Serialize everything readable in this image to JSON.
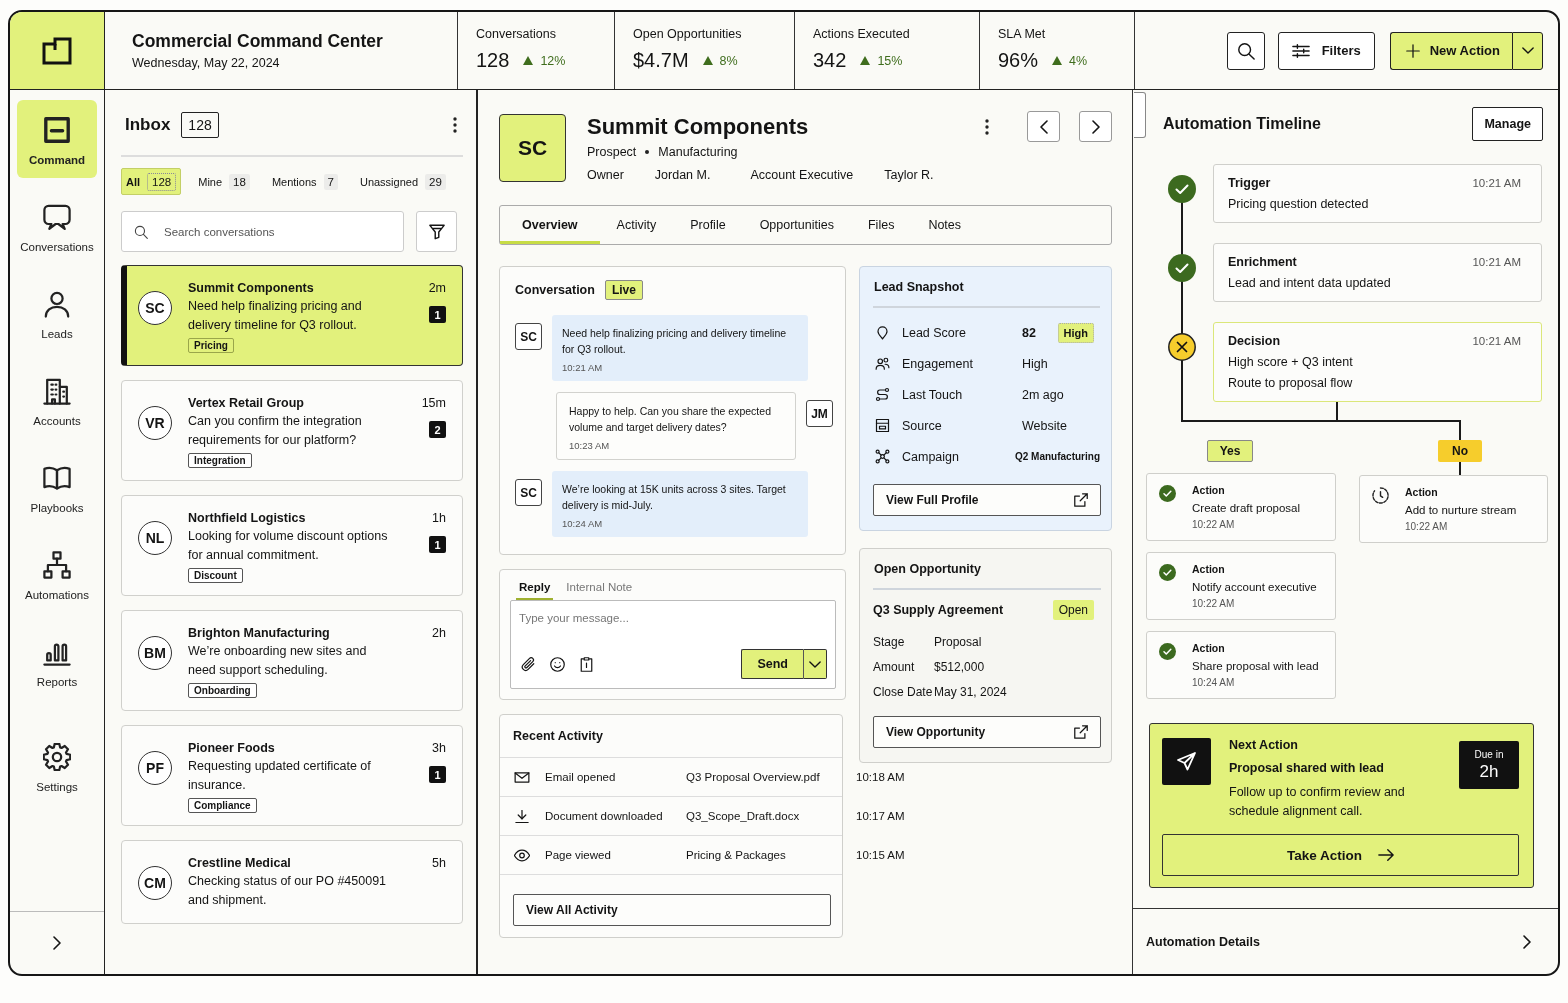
{
  "header": {
    "title": "Commercial Command Center",
    "date": "Wednesday, May 22, 2024"
  },
  "stats": [
    {
      "label": "Conversations",
      "value": "128",
      "change": "12%"
    },
    {
      "label": "Open Opportunities",
      "value": "$4.7M",
      "change": "8%"
    },
    {
      "label": "Actions Executed",
      "value": "342",
      "change": "15%"
    },
    {
      "label": "SLA Met",
      "value": "96%",
      "change": "4%"
    }
  ],
  "toolbar": {
    "filters": "Filters",
    "new_action": "New Action"
  },
  "sidebar": {
    "items": [
      {
        "label": "Command",
        "selected": true
      },
      {
        "label": "Conversations",
        "selected": false
      },
      {
        "label": "Leads",
        "selected": false
      },
      {
        "label": "Accounts",
        "selected": false
      },
      {
        "label": "Playbooks",
        "selected": false
      },
      {
        "label": "Automations",
        "selected": false
      },
      {
        "label": "Reports",
        "selected": false
      },
      {
        "label": "Settings",
        "selected": false
      }
    ]
  },
  "inbox": {
    "title": "Inbox",
    "count": "128",
    "filters": [
      {
        "label": "All",
        "count": "128",
        "selected": true
      },
      {
        "label": "Mine",
        "count": "18",
        "selected": false
      },
      {
        "label": "Mentions",
        "count": "7",
        "selected": false
      },
      {
        "label": "Unassigned",
        "count": "29",
        "selected": false
      }
    ],
    "search": {
      "placeholder": "Search conversations"
    },
    "conversations": [
      {
        "initials": "SC",
        "name": "Summit Components",
        "message": "Need help finalizing pricing and delivery timeline for Q3 rollout.",
        "time": "2m",
        "unread": "1",
        "tag": "Pricing",
        "selected": true
      },
      {
        "initials": "VR",
        "name": "Vertex Retail Group",
        "message": "Can you confirm the integration requirements for our platform?",
        "time": "15m",
        "unread": "2",
        "tag": "Integration",
        "selected": false
      },
      {
        "initials": "NL",
        "name": "Northfield Logistics",
        "message": "Looking for volume discount options for annual commitment.",
        "time": "1h",
        "unread": "1",
        "tag": "Discount",
        "selected": false
      },
      {
        "initials": "BM",
        "name": "Brighton Manufacturing",
        "message": "We’re onboarding new sites and need support scheduling.",
        "time": "2h",
        "tag": "Onboarding",
        "selected": false
      },
      {
        "initials": "PF",
        "name": "Pioneer Foods",
        "message": "Requesting updated certificate of insurance.",
        "time": "3h",
        "unread": "1",
        "tag": "Compliance",
        "selected": false
      },
      {
        "initials": "CM",
        "name": "Crestline Medical",
        "message": "Checking status of our PO #450091 and shipment.",
        "time": "5h",
        "selected": false
      }
    ]
  },
  "account": {
    "initials": "SC",
    "name": "Summit Components",
    "type": "Prospect",
    "industry": "Manufacturing",
    "fields": [
      {
        "label": "Owner",
        "value": "Jordan M."
      },
      {
        "label": "Account Executive",
        "value": "Taylor R."
      }
    ]
  },
  "tabs": [
    {
      "label": "Overview",
      "selected": true
    },
    {
      "label": "Activity",
      "selected": false
    },
    {
      "label": "Profile",
      "selected": false
    },
    {
      "label": "Opportunities",
      "selected": false
    },
    {
      "label": "Files",
      "selected": false
    },
    {
      "label": "Notes",
      "selected": false
    }
  ],
  "conversation": {
    "title": "Conversation",
    "status": "Live",
    "messages": [
      {
        "kind": "inbound",
        "initials": "SC",
        "text": "Need help finalizing pricing and delivery timeline for Q3 rollout.",
        "time": "10:21 AM"
      },
      {
        "kind": "outbound",
        "initials": "JM",
        "text": "Happy to help. Can you share the expected volume and target delivery dates?",
        "time": "10:23 AM"
      },
      {
        "kind": "inbound",
        "initials": "SC",
        "text": "We’re looking at 15K units across 3 sites. Target delivery is mid-July.",
        "time": "10:24 AM"
      }
    ]
  },
  "reply": {
    "tabs": [
      {
        "label": "Reply",
        "selected": true
      },
      {
        "label": "Internal Note",
        "selected": false
      }
    ],
    "placeholder": "Type your message...",
    "send": "Send"
  },
  "recent_activity": {
    "title": "Recent Activity",
    "rows": [
      {
        "event": "Email opened",
        "item": "Q3 Proposal Overview.pdf",
        "time": "10:18 AM"
      },
      {
        "event": "Document downloaded",
        "item": "Q3_Scope_Draft.docx",
        "time": "10:17 AM"
      },
      {
        "event": "Page viewed",
        "item": "Pricing & Packages",
        "time": "10:15 AM"
      }
    ],
    "button": "View All Activity"
  },
  "lead_snapshot": {
    "title": "Lead Snapshot",
    "rows": [
      {
        "kind": "score",
        "label": "Lead Score",
        "value": "82",
        "badge": "High"
      },
      {
        "kind": "plain",
        "label": "Engagement",
        "value": "High"
      },
      {
        "kind": "plain",
        "label": "Last Touch",
        "value": "2m ago"
      },
      {
        "kind": "plain",
        "label": "Source",
        "value": "Website"
      },
      {
        "kind": "compact",
        "label": "Campaign",
        "value": "Q2 Manufacturing"
      }
    ],
    "button": "View Full Profile"
  },
  "opportunity": {
    "title": "Open Opportunity",
    "name": "Q3 Supply Agreement",
    "status": "Open",
    "fields": [
      {
        "label": "Stage",
        "value": "Proposal"
      },
      {
        "label": "Amount",
        "value": "$512,000"
      },
      {
        "label": "Close Date",
        "value": "May 31, 2024"
      }
    ],
    "button": "View Opportunity"
  },
  "automation": {
    "title": "Automation Timeline",
    "manage": "Manage",
    "steps": [
      {
        "kind": "done",
        "title": "Trigger",
        "time": "10:21 AM",
        "lines": [
          "Pricing question detected"
        ]
      },
      {
        "kind": "done",
        "title": "Enrichment",
        "time": "10:21 AM",
        "lines": [
          "Lead and intent data updated"
        ]
      },
      {
        "kind": "decision",
        "title": "Decision",
        "time": "10:21 AM",
        "lines": [
          "High score + Q3 intent",
          "Route to proposal flow"
        ]
      }
    ],
    "branches": [
      {
        "label": "Yes",
        "color": "#e2f17c",
        "actions": [
          {
            "title": "Action",
            "text": "Create draft proposal",
            "time": "10:22 AM",
            "done": true
          },
          {
            "title": "Action",
            "text": "Notify account executive",
            "time": "10:22 AM",
            "done": true
          },
          {
            "title": "Action",
            "text": "Share proposal with lead",
            "time": "10:24 AM",
            "done": true
          }
        ]
      },
      {
        "label": "No",
        "color": "#f6cd2c",
        "actions": [
          {
            "title": "Action",
            "text": "Add to nurture stream",
            "time": "10:22 AM",
            "done": false
          }
        ]
      }
    ],
    "next_action": {
      "title": "Next Action",
      "headline": "Proposal shared with lead",
      "text": "Follow up to confirm review and schedule alignment call.",
      "due_label": "Due in",
      "due": "2h",
      "button": "Take Action"
    },
    "details": "Automation Details"
  }
}
